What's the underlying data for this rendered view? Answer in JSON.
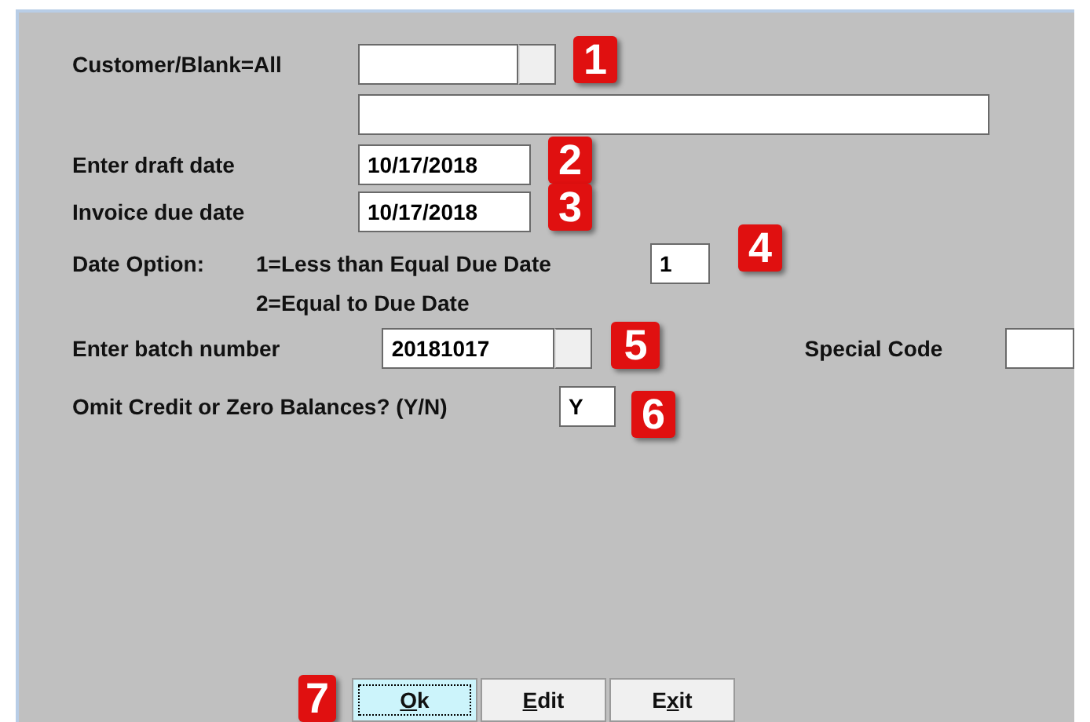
{
  "customer": {
    "label": "Customer/Blank=All",
    "badge": "1"
  },
  "draft_date": {
    "label": "Enter draft date",
    "value": "10/17/2018",
    "badge": "2"
  },
  "due_date": {
    "label": "Invoice due date",
    "value": "10/17/2018",
    "badge": "3"
  },
  "date_option": {
    "label": "Date Option:",
    "option_1": "1=Less than Equal Due Date",
    "option_2": "2=Equal to Due Date",
    "value": "1",
    "badge": "4"
  },
  "batch": {
    "label": "Enter batch number",
    "value": "20181017",
    "badge": "5"
  },
  "special_code": {
    "label": "Special Code"
  },
  "omit": {
    "label": "Omit Credit or Zero Balances? (Y/N)",
    "value": "Y",
    "badge": "6"
  },
  "buttons_badge": "7",
  "buttons": [
    {
      "hotkey": "O",
      "after": "k",
      "focused": true
    },
    {
      "hotkey": "E",
      "after": "dit",
      "focused": false
    },
    {
      "before": "E",
      "hotkey": "x",
      "after": "it",
      "focused": false
    }
  ]
}
